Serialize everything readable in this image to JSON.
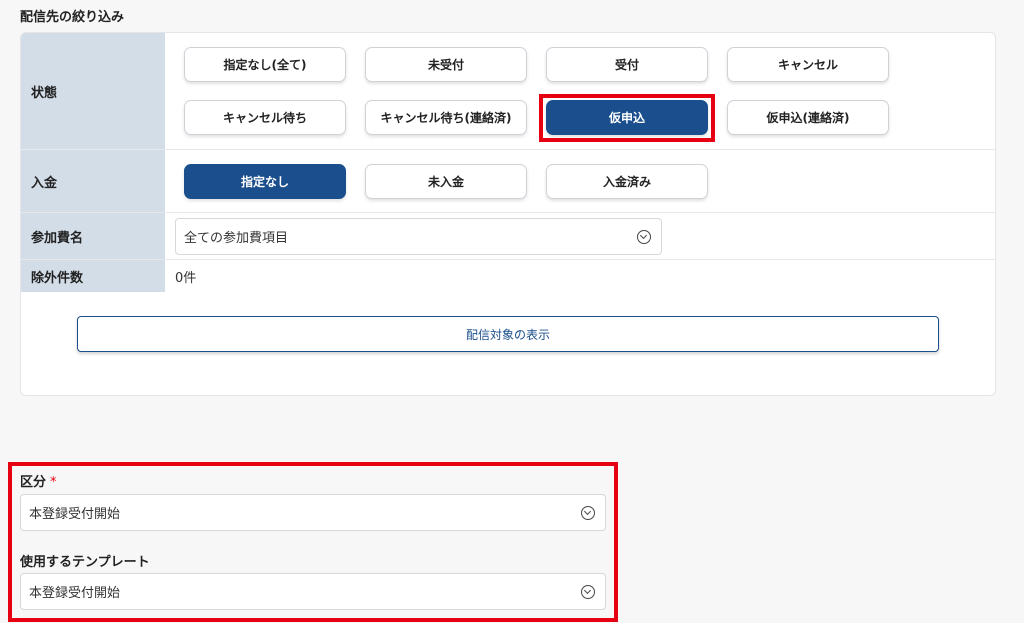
{
  "filter": {
    "title": "配信先の絞り込み",
    "status": {
      "label": "状態",
      "options": [
        "指定なし(全て)",
        "未受付",
        "受付",
        "キャンセル",
        "キャンセル待ち",
        "キャンセル待ち(連絡済)",
        "仮申込",
        "仮申込(連絡済)"
      ],
      "selected": "仮申込"
    },
    "payment": {
      "label": "入金",
      "options": [
        "指定なし",
        "未入金",
        "入金済み"
      ],
      "selected": "指定なし"
    },
    "fee": {
      "label": "参加費名",
      "value": "全ての参加費項目"
    },
    "excluded": {
      "label": "除外件数",
      "value": "0件"
    },
    "show_button_label": "配信対象の表示"
  },
  "form": {
    "category": {
      "label": "区分",
      "required_mark": "*",
      "value": "本登録受付開始"
    },
    "template": {
      "label": "使用するテンプレート",
      "value": "本登録受付開始"
    }
  },
  "colors": {
    "accent": "#1a4e8c",
    "highlight": "#e60012",
    "label_bg": "#d3dde8"
  }
}
